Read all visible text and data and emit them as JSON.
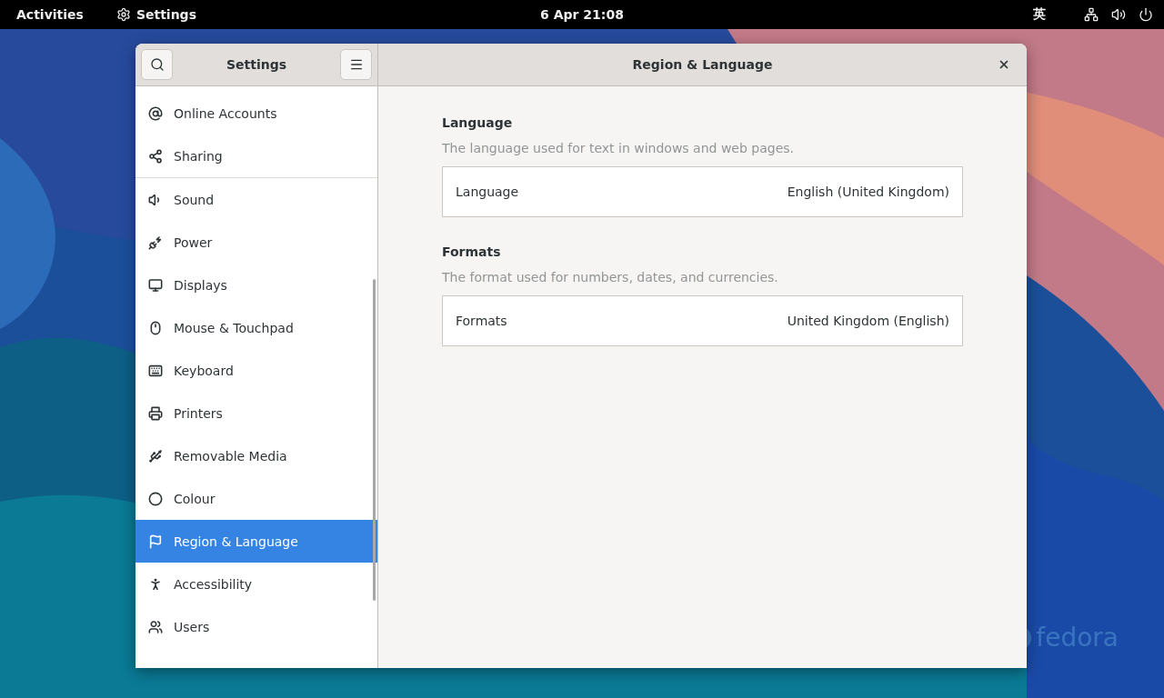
{
  "top_bar": {
    "activities": "Activities",
    "app_name": "Settings",
    "clock": "6 Apr  21:08",
    "input_method": "英"
  },
  "desktop": {
    "logo_text": "fedora"
  },
  "window": {
    "sidebar_title": "Settings",
    "title": "Region & Language"
  },
  "sidebar": {
    "groups": [
      [
        {
          "label": "Online Accounts",
          "selected": false
        },
        {
          "label": "Sharing",
          "selected": false
        }
      ],
      [
        {
          "label": "Sound",
          "selected": false
        },
        {
          "label": "Power",
          "selected": false
        },
        {
          "label": "Displays",
          "selected": false
        },
        {
          "label": "Mouse & Touchpad",
          "selected": false
        },
        {
          "label": "Keyboard",
          "selected": false
        },
        {
          "label": "Printers",
          "selected": false
        },
        {
          "label": "Removable Media",
          "selected": false
        },
        {
          "label": "Colour",
          "selected": false
        },
        {
          "label": "Region & Language",
          "selected": true
        },
        {
          "label": "Accessibility",
          "selected": false
        },
        {
          "label": "Users",
          "selected": false
        }
      ]
    ]
  },
  "sections": [
    {
      "heading": "Language",
      "description": "The language used for text in windows and web pages.",
      "row": {
        "label": "Language",
        "value": "English (United Kingdom)"
      }
    },
    {
      "heading": "Formats",
      "description": "The format used for numbers, dates, and currencies.",
      "row": {
        "label": "Formats",
        "value": "United Kingdom (English)"
      }
    }
  ]
}
